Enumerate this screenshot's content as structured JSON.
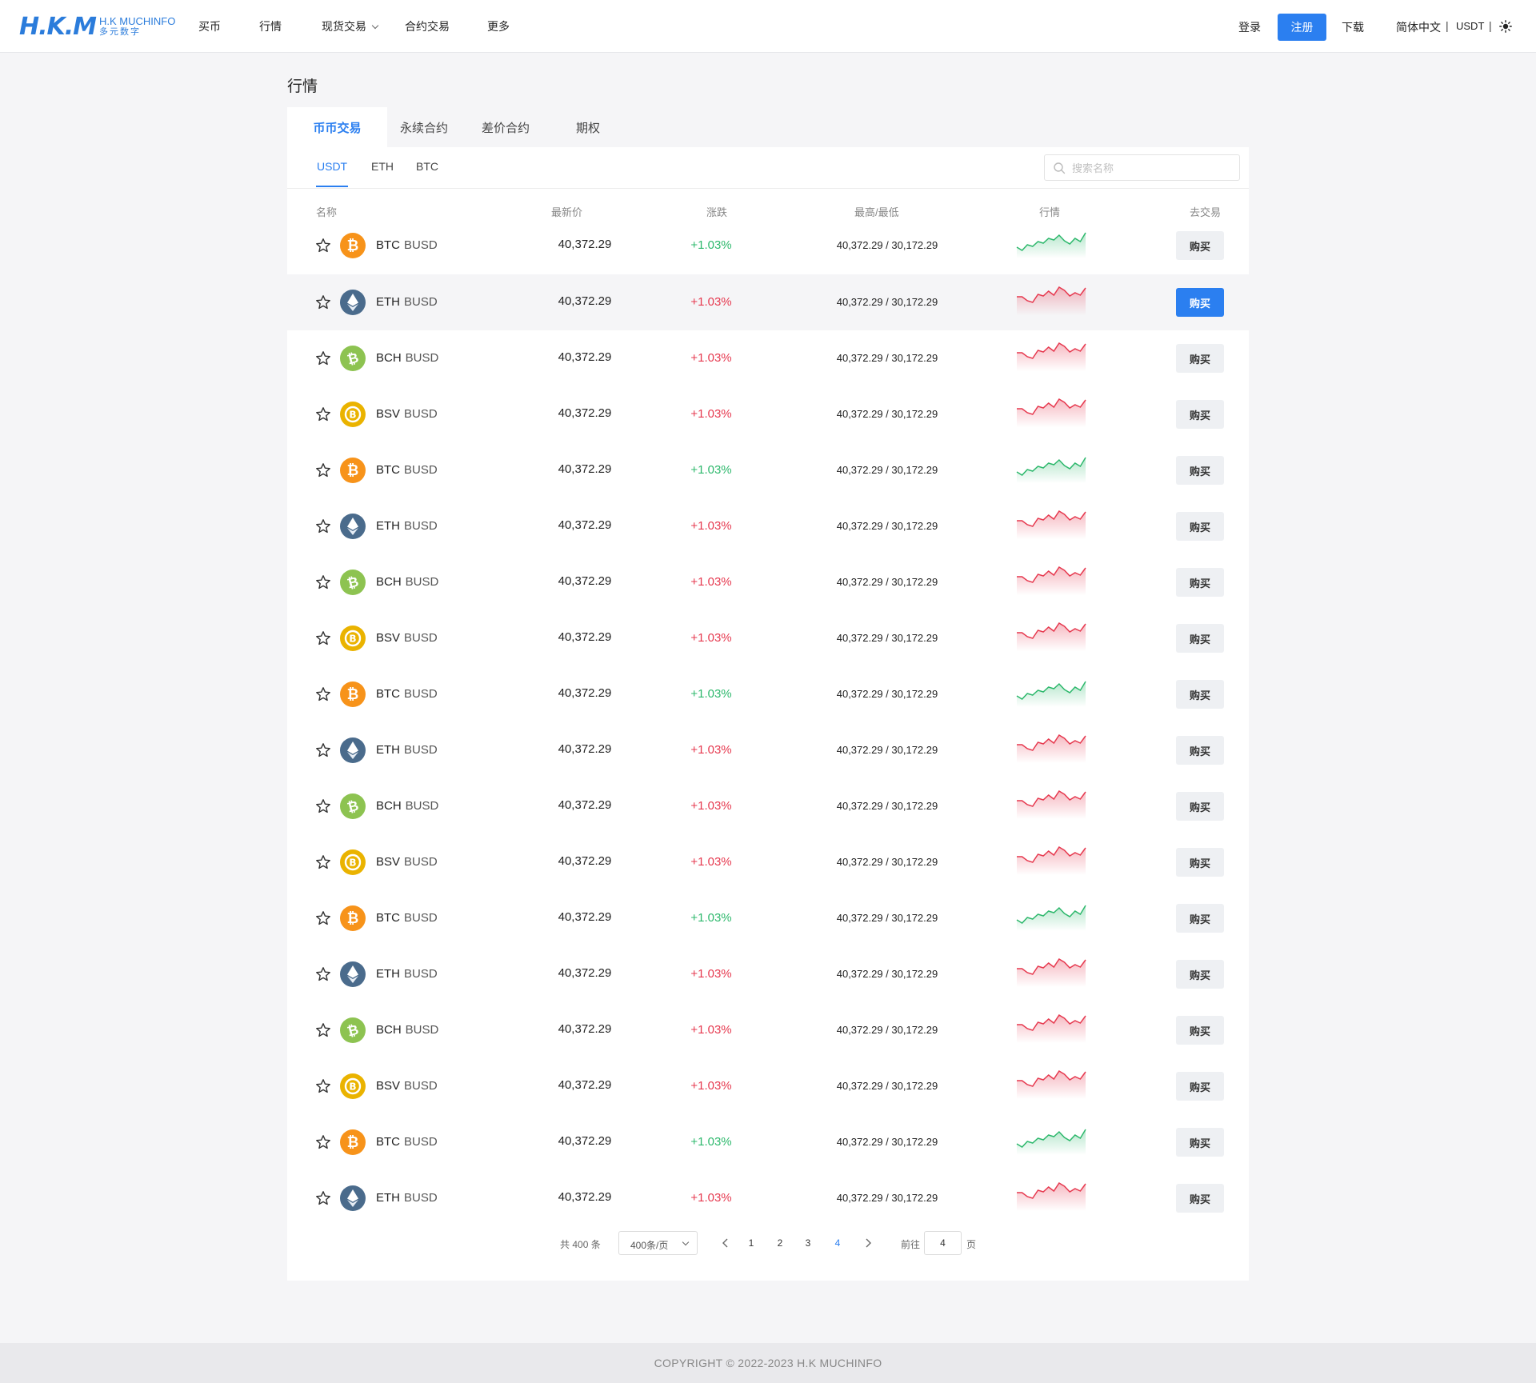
{
  "header": {
    "logo_mark": "H.K.M",
    "logo_en": "H.K MUCHINFO",
    "logo_cn": "多元数字",
    "nav": [
      "买币",
      "行情",
      "现货交易",
      "合约交易",
      "更多"
    ],
    "login": "登录",
    "register": "注册",
    "download": "下载",
    "language": "简体中文",
    "separator": "|",
    "currency": "USDT"
  },
  "page_title": "行情",
  "tabs": [
    "币币交易",
    "永续合约",
    "差价合约",
    "期权"
  ],
  "subtabs": [
    "USDT",
    "ETH",
    "BTC"
  ],
  "search": {
    "placeholder": "搜索名称"
  },
  "columns": [
    "名称",
    "最新价",
    "涨跌",
    "最高/最低",
    "行情",
    "去交易"
  ],
  "rows": [
    {
      "base": "BTC",
      "quote": "BUSD",
      "price": "40,372.29",
      "change": "+1.03%",
      "high_low": "40,372.29 / 30,172.29",
      "trend": "up",
      "buy": "购买"
    },
    {
      "base": "ETH",
      "quote": "BUSD",
      "price": "40,372.29",
      "change": "+1.03%",
      "high_low": "40,372.29 / 30,172.29",
      "trend": "down",
      "buy": "购买"
    },
    {
      "base": "BCH",
      "quote": "BUSD",
      "price": "40,372.29",
      "change": "+1.03%",
      "high_low": "40,372.29 / 30,172.29",
      "trend": "down",
      "buy": "购买"
    },
    {
      "base": "BSV",
      "quote": "BUSD",
      "price": "40,372.29",
      "change": "+1.03%",
      "high_low": "40,372.29 / 30,172.29",
      "trend": "down",
      "buy": "购买"
    },
    {
      "base": "BTC",
      "quote": "BUSD",
      "price": "40,372.29",
      "change": "+1.03%",
      "high_low": "40,372.29 / 30,172.29",
      "trend": "up",
      "buy": "购买"
    },
    {
      "base": "ETH",
      "quote": "BUSD",
      "price": "40,372.29",
      "change": "+1.03%",
      "high_low": "40,372.29 / 30,172.29",
      "trend": "down",
      "buy": "购买"
    },
    {
      "base": "BCH",
      "quote": "BUSD",
      "price": "40,372.29",
      "change": "+1.03%",
      "high_low": "40,372.29 / 30,172.29",
      "trend": "down",
      "buy": "购买"
    },
    {
      "base": "BSV",
      "quote": "BUSD",
      "price": "40,372.29",
      "change": "+1.03%",
      "high_low": "40,372.29 / 30,172.29",
      "trend": "down",
      "buy": "购买"
    },
    {
      "base": "BTC",
      "quote": "BUSD",
      "price": "40,372.29",
      "change": "+1.03%",
      "high_low": "40,372.29 / 30,172.29",
      "trend": "up",
      "buy": "购买"
    },
    {
      "base": "ETH",
      "quote": "BUSD",
      "price": "40,372.29",
      "change": "+1.03%",
      "high_low": "40,372.29 / 30,172.29",
      "trend": "down",
      "buy": "购买"
    },
    {
      "base": "BCH",
      "quote": "BUSD",
      "price": "40,372.29",
      "change": "+1.03%",
      "high_low": "40,372.29 / 30,172.29",
      "trend": "down",
      "buy": "购买"
    },
    {
      "base": "BSV",
      "quote": "BUSD",
      "price": "40,372.29",
      "change": "+1.03%",
      "high_low": "40,372.29 / 30,172.29",
      "trend": "down",
      "buy": "购买"
    },
    {
      "base": "BTC",
      "quote": "BUSD",
      "price": "40,372.29",
      "change": "+1.03%",
      "high_low": "40,372.29 / 30,172.29",
      "trend": "up",
      "buy": "购买"
    },
    {
      "base": "ETH",
      "quote": "BUSD",
      "price": "40,372.29",
      "change": "+1.03%",
      "high_low": "40,372.29 / 30,172.29",
      "trend": "down",
      "buy": "购买"
    },
    {
      "base": "BCH",
      "quote": "BUSD",
      "price": "40,372.29",
      "change": "+1.03%",
      "high_low": "40,372.29 / 30,172.29",
      "trend": "down",
      "buy": "购买"
    },
    {
      "base": "BSV",
      "quote": "BUSD",
      "price": "40,372.29",
      "change": "+1.03%",
      "high_low": "40,372.29 / 30,172.29",
      "trend": "down",
      "buy": "购买"
    },
    {
      "base": "BTC",
      "quote": "BUSD",
      "price": "40,372.29",
      "change": "+1.03%",
      "high_low": "40,372.29 / 30,172.29",
      "trend": "up",
      "buy": "购买"
    },
    {
      "base": "ETH",
      "quote": "BUSD",
      "price": "40,372.29",
      "change": "+1.03%",
      "high_low": "40,372.29 / 30,172.29",
      "trend": "down",
      "buy": "购买"
    }
  ],
  "highlighted_row": 1,
  "pagination": {
    "total_prefix": "共",
    "total": "400",
    "total_suffix": "条",
    "page_size": "400条/页",
    "pages": [
      "1",
      "2",
      "3",
      "4"
    ],
    "current": "4",
    "goto_label": "前往",
    "goto_value": "4",
    "page_label": "页"
  },
  "footer": "COPYRIGHT © 2022-2023 H.K MUCHINFO",
  "colors": {
    "accent": "#2b7ff0",
    "up": "#2db86c",
    "down": "#e6394f",
    "BTC": "#f7931a",
    "ETH": "#4a6b8c",
    "BCH": "#8dc351",
    "BSV": "#eab300"
  }
}
